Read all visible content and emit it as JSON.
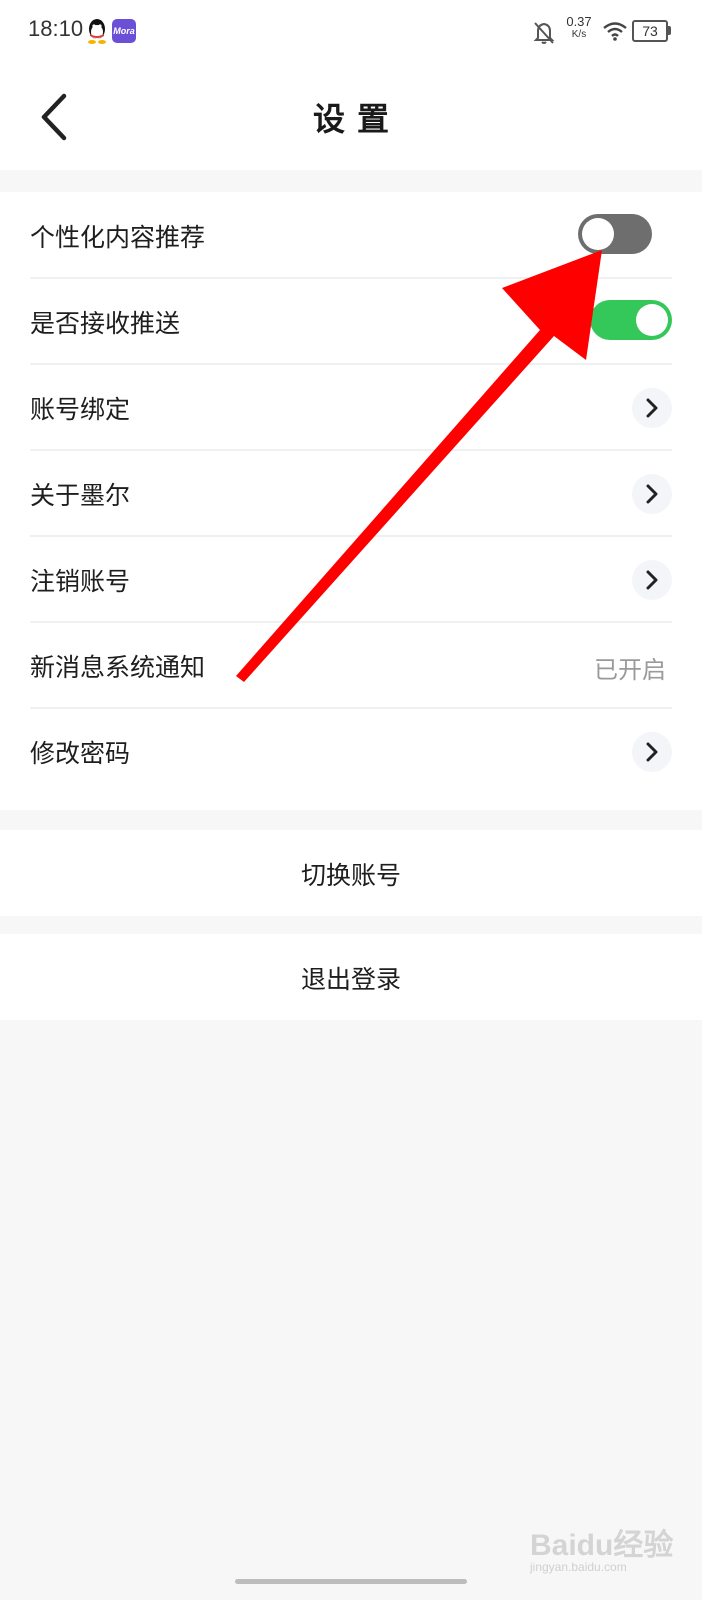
{
  "status_bar": {
    "time": "18:10",
    "app_badge": "Mora",
    "net_speed_value": "0.37",
    "net_speed_unit": "K/s",
    "battery": "73",
    "icons": [
      "qq-icon",
      "mora-app-icon",
      "bell-off-icon",
      "wifi-icon",
      "battery-icon"
    ]
  },
  "header": {
    "title": "设置",
    "back_icon": "chevron-left-icon"
  },
  "settings": {
    "items": [
      {
        "label": "个性化内容推荐",
        "control": "toggle",
        "state": "off"
      },
      {
        "label": "是否接收推送",
        "control": "toggle",
        "state": "on"
      },
      {
        "label": "账号绑定",
        "control": "chevron"
      },
      {
        "label": "关于墨尔",
        "control": "chevron"
      },
      {
        "label": "注销账号",
        "control": "chevron"
      },
      {
        "label": "新消息系统通知",
        "control": "value",
        "value": "已开启"
      },
      {
        "label": "修改密码",
        "control": "chevron"
      }
    ]
  },
  "actions": {
    "switch_account": "切换账号",
    "logout": "退出登录"
  },
  "watermark": {
    "brand": "Baidu经验",
    "url": "jingyan.baidu.com"
  },
  "colors": {
    "toggle_on": "#34c759",
    "toggle_off": "#6e6e6e",
    "annotation_arrow": "#ff0000",
    "page_background": "#f7f7f7"
  }
}
